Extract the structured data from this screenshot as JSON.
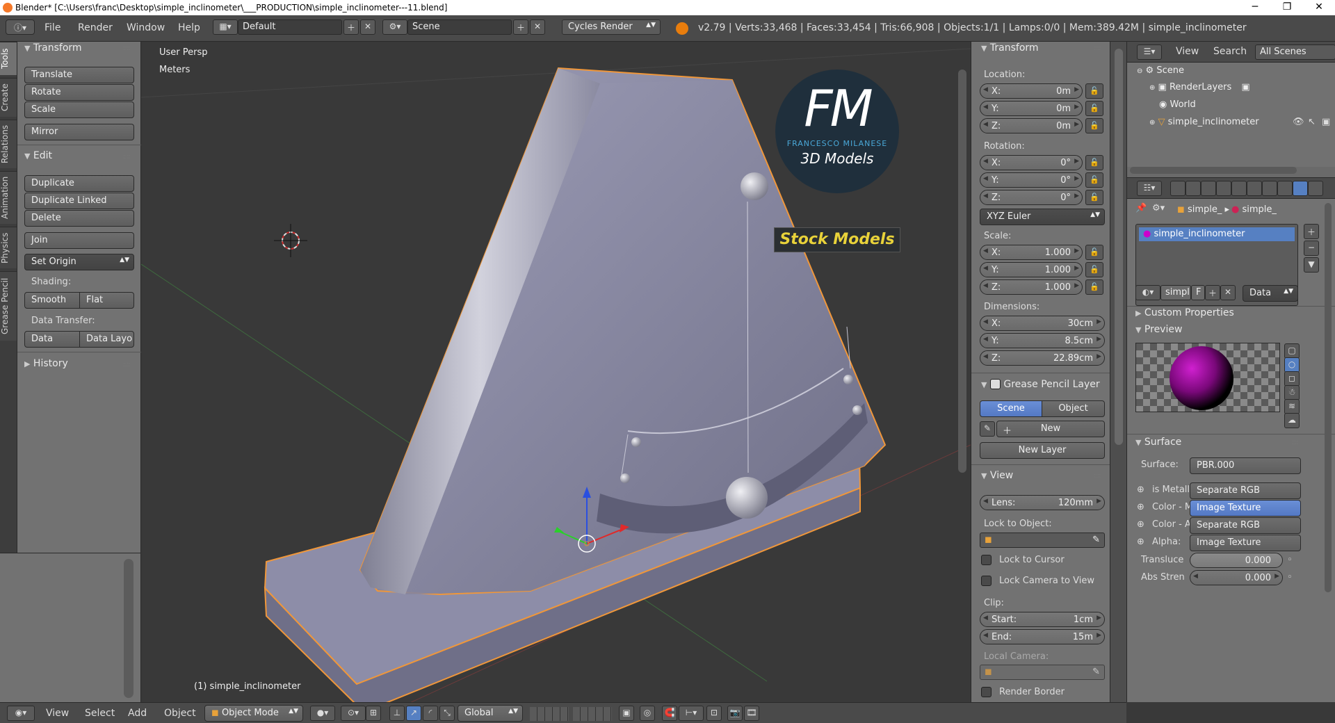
{
  "window": {
    "title": "Blender* [C:\\Users\\franc\\Desktop\\simple_inclinometer\\___PRODUCTION\\simple_inclinometer---11.blend]",
    "min": "─",
    "max": "❐",
    "close": "✕"
  },
  "info": {
    "menus": [
      "File",
      "Render",
      "Window",
      "Help"
    ],
    "layout": "Default",
    "scene": "Scene",
    "engine": "Cycles Render",
    "stats": "v2.79 | Verts:33,468 | Faces:33,454 | Tris:66,908 | Objects:1/1 | Lamps:0/0 | Mem:389.42M | simple_inclinometer"
  },
  "toolshelf": {
    "tabs": [
      "Tools",
      "Create",
      "Relations",
      "Animation",
      "Physics",
      "Grease Pencil"
    ],
    "transform_header": "Transform",
    "transform": [
      "Translate",
      "Rotate",
      "Scale"
    ],
    "mirror": "Mirror",
    "edit_header": "Edit",
    "edit": [
      "Duplicate",
      "Duplicate Linked",
      "Delete"
    ],
    "join": "Join",
    "set_origin": "Set Origin",
    "shading_label": "Shading:",
    "smooth": "Smooth",
    "flat": "Flat",
    "data_transfer_label": "Data Transfer:",
    "data": "Data",
    "data_layo": "Data Layo",
    "history_header": "History"
  },
  "viewport": {
    "view_name": "User Persp",
    "units": "Meters",
    "object_label": "(1) simple_inclinometer",
    "watermark": {
      "monogram": "FM",
      "name": "FRANCESCO MILANESE",
      "tagline": "3D Models",
      "badge": "Stock Models"
    }
  },
  "bottom": {
    "menus": [
      "View",
      "Select",
      "Add",
      "Object"
    ],
    "mode": "Object Mode",
    "orientation": "Global"
  },
  "npanel": {
    "transform_header": "Transform",
    "location_label": "Location:",
    "location": [
      {
        "k": "X:",
        "v": "0m"
      },
      {
        "k": "Y:",
        "v": "0m"
      },
      {
        "k": "Z:",
        "v": "0m"
      }
    ],
    "rotation_label": "Rotation:",
    "rotation": [
      {
        "k": "X:",
        "v": "0°"
      },
      {
        "k": "Y:",
        "v": "0°"
      },
      {
        "k": "Z:",
        "v": "0°"
      }
    ],
    "rotation_mode": "XYZ Euler",
    "scale_label": "Scale:",
    "scale": [
      {
        "k": "X:",
        "v": "1.000"
      },
      {
        "k": "Y:",
        "v": "1.000"
      },
      {
        "k": "Z:",
        "v": "1.000"
      }
    ],
    "dimensions_label": "Dimensions:",
    "dimensions": [
      {
        "k": "X:",
        "v": "30cm"
      },
      {
        "k": "Y:",
        "v": "8.5cm"
      },
      {
        "k": "Z:",
        "v": "22.89cm"
      }
    ],
    "gp_header": "Grease Pencil Layer",
    "gp_scene": "Scene",
    "gp_object": "Object",
    "gp_new": "New",
    "gp_new_layer": "New Layer",
    "view_header": "View",
    "lens_k": "Lens:",
    "lens_v": "120mm",
    "lock_to_object": "Lock to Object:",
    "lock_to_cursor": "Lock to Cursor",
    "lock_camera": "Lock Camera to View",
    "clip_label": "Clip:",
    "clip_start_k": "Start:",
    "clip_start_v": "1cm",
    "clip_end_k": "End:",
    "clip_end_v": "15m",
    "local_camera": "Local Camera:",
    "render_border": "Render Border"
  },
  "outliner": {
    "view": "View",
    "search": "Search",
    "filter": "All Scenes",
    "rows": [
      "Scene",
      "RenderLayers",
      "World",
      "simple_inclinometer"
    ]
  },
  "properties": {
    "crumb1": "simple_",
    "crumb2": "simple_",
    "material_slot": "simple_inclinometer",
    "mat_name": "simpl",
    "mat_f": "F",
    "mat_data": "Data",
    "custom_props": "Custom Properties",
    "preview": "Preview",
    "surface_header": "Surface",
    "surface_label": "Surface:",
    "surface_value": "PBR.000",
    "inputs": [
      {
        "k": "is Metallic",
        "v": "Separate RGB"
      },
      {
        "k": "Color - Ma",
        "v": "Image Texture"
      },
      {
        "k": "Color - Ab",
        "v": "Separate RGB"
      },
      {
        "k": "Alpha:",
        "v": "Image Texture"
      }
    ],
    "transl_k": "Transluce",
    "transl_v": "0.000",
    "abs_k": "Abs Stren",
    "abs_v": "0.000"
  },
  "colors": {
    "viewport_bg": "#393939",
    "panel_bg": "#727272",
    "selection": "#5680c2",
    "model": "#8f8fa8",
    "outline": "#f0973a",
    "badge_text": "#e8d23a"
  }
}
